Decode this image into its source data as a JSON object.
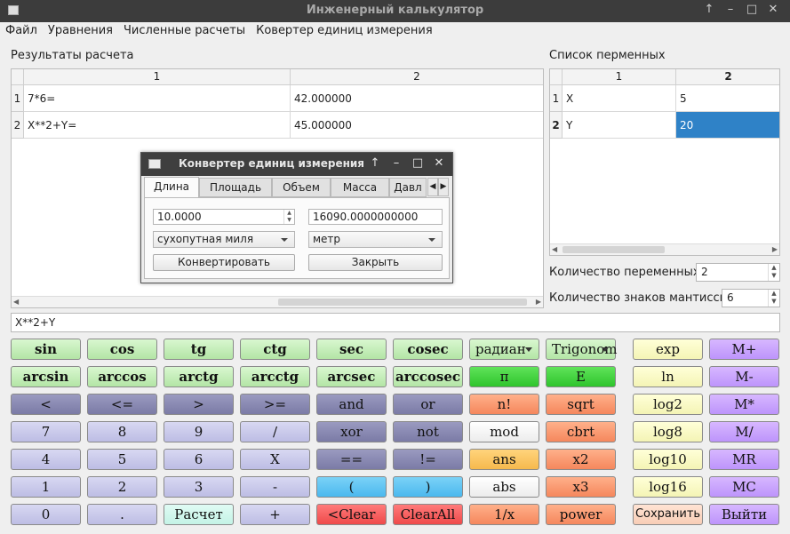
{
  "window": {
    "title": "Инженерный калькулятор"
  },
  "menu": [
    "Файл",
    "Уравнения",
    "Численные расчеты",
    "Ковертер единиц измерения"
  ],
  "results": {
    "label": "Результаты расчета",
    "columns": [
      "1",
      "2"
    ],
    "rows": [
      {
        "num": "1",
        "expr": "7*6=",
        "value": "42.000000"
      },
      {
        "num": "2",
        "expr": "X**2+Y=",
        "value": "45.000000"
      }
    ]
  },
  "variables": {
    "label": "Список перменных",
    "columns": [
      "1",
      "2"
    ],
    "rows": [
      {
        "num": "1",
        "name": "X",
        "value": "5"
      },
      {
        "num": "2",
        "name": "Y",
        "value": "20"
      }
    ],
    "count_label": "Количество переменных",
    "count_value": "2",
    "mantissa_label": "Количество знаков мантиссы",
    "mantissa_value": "6"
  },
  "expression": "X**2+Y",
  "buttons": {
    "sin": "sin",
    "cos": "cos",
    "tg": "tg",
    "ctg": "ctg",
    "sec": "sec",
    "cosec": "cosec",
    "angle_mode": "радиан",
    "func_mode": "Trigonom",
    "exp": "exp",
    "mplus": "M+",
    "arcsin": "arcsin",
    "arccos": "arccos",
    "arctg": "arctg",
    "arcctg": "arcctg",
    "arcsec": "arcsec",
    "arccosec": "arccosec",
    "pi": "π",
    "e": "E",
    "ln": "ln",
    "mminus": "M-",
    "lt": "<",
    "le": "<=",
    "gt": ">",
    "ge": ">=",
    "and": "and",
    "or": "or",
    "fact": "n!",
    "sqrt": "sqrt",
    "log2": "log2",
    "mmul": "M*",
    "d7": "7",
    "d8": "8",
    "d9": "9",
    "div": "/",
    "xor": "xor",
    "not": "not",
    "mod": "mod",
    "cbrt": "cbrt",
    "log8": "log8",
    "mdiv": "M/",
    "d4": "4",
    "d5": "5",
    "d6": "6",
    "mulx": "X",
    "eq": "==",
    "ne": "!=",
    "ans": "ans",
    "x2": "x2",
    "log10": "log10",
    "mr": "MR",
    "d1": "1",
    "d2": "2",
    "d3": "3",
    "minus": "-",
    "lpar": "(",
    "rpar": ")",
    "abs": "abs",
    "x3": "x3",
    "log16": "log16",
    "mc": "MC",
    "d0": "0",
    "dot": ".",
    "calc": "Расчет",
    "plus": "+",
    "lclear": "<Clear",
    "clearall": "ClearAll",
    "recip": "1/x",
    "power": "power",
    "save": "Сохранить",
    "exit": "Выйти"
  },
  "dialog": {
    "title": "Конвертер единиц измерения",
    "tabs": [
      "Длина",
      "Площадь",
      "Объем",
      "Масса",
      "Давл"
    ],
    "input_value": "10.0000",
    "output_value": "16090.0000000000",
    "from_unit": "сухопутная миля",
    "to_unit": "метр",
    "convert_label": "Конвертировать",
    "close_label": "Закрыть"
  }
}
